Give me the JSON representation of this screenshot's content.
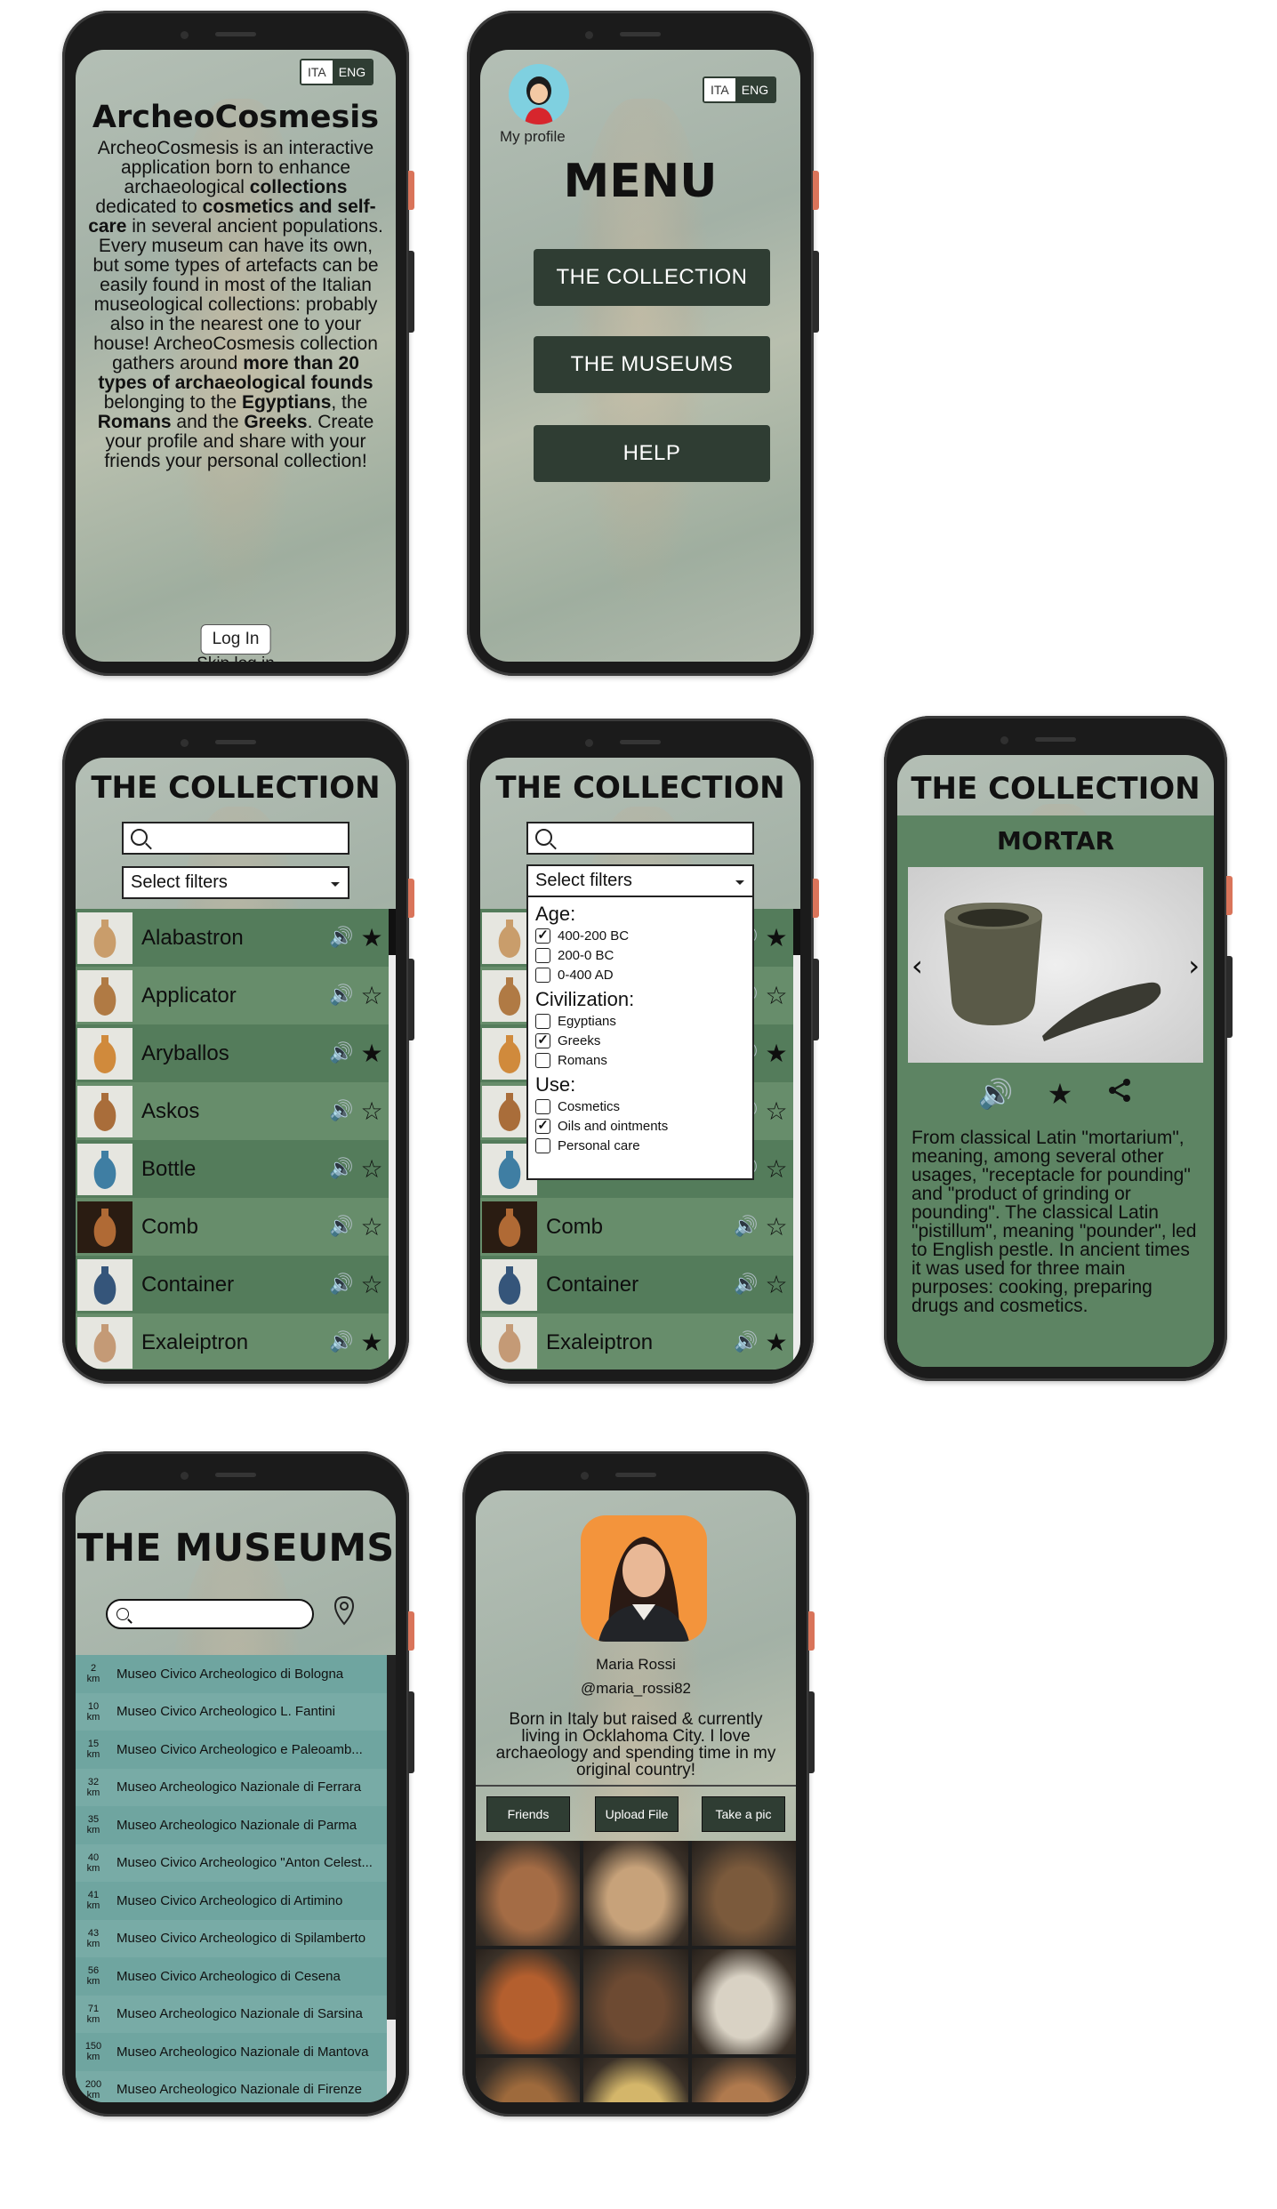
{
  "lang_toggle": {
    "ita": "ITA",
    "eng": "ENG"
  },
  "intro_screen": {
    "title": "ArcheoCosmesis",
    "description_parts": [
      {
        "t": "ArcheoCosmesis is an interactive application born to enhance archaeological ",
        "b": false
      },
      {
        "t": "collections",
        "b": true
      },
      {
        "t": " dedicated to ",
        "b": false
      },
      {
        "t": "cosmetics and self-care",
        "b": true
      },
      {
        "t": " in several ancient populations. Every museum can have its own, but some types of artefacts can be easily found in most of the Italian museological collections: probably also in the nearest one to your house! ArcheoCosmesis collection gathers around ",
        "b": false
      },
      {
        "t": "more than 20 types of archaeological founds",
        "b": true
      },
      {
        "t": " belonging to the ",
        "b": false
      },
      {
        "t": "Egyptians",
        "b": true
      },
      {
        "t": ", the ",
        "b": false
      },
      {
        "t": "Romans",
        "b": true
      },
      {
        "t": " and the ",
        "b": false
      },
      {
        "t": "Greeks",
        "b": true
      },
      {
        "t": ". Create your profile and share with your friends your personal collection!",
        "b": false
      }
    ],
    "login_label": "Log In",
    "skip_label": "Skip log in"
  },
  "menu_screen": {
    "profile_label": "My profile",
    "title": "MENU",
    "buttons": [
      "THE COLLECTION",
      "THE MUSEUMS",
      "HELP"
    ]
  },
  "collection_screen": {
    "title": "THE COLLECTION",
    "search_placeholder": "",
    "filter_label": "Select filters",
    "items": [
      {
        "name": "Alabastron",
        "favorite": true,
        "thumb_color": "#c99d6b"
      },
      {
        "name": "Applicator",
        "favorite": false,
        "thumb_color": "#b07a44"
      },
      {
        "name": "Aryballos",
        "favorite": true,
        "thumb_color": "#d08a3c"
      },
      {
        "name": "Askos",
        "favorite": false,
        "thumb_color": "#a96d3a"
      },
      {
        "name": "Bottle",
        "favorite": false,
        "thumb_color": "#3f7ea3"
      },
      {
        "name": "Comb",
        "favorite": false,
        "thumb_color": "#b06a35"
      },
      {
        "name": "Container",
        "favorite": false,
        "thumb_color": "#35557a"
      },
      {
        "name": "Exaleiptron",
        "favorite": true,
        "thumb_color": "#c49a76"
      }
    ]
  },
  "filters": {
    "age_title": "Age:",
    "age_options": [
      {
        "label": "400-200 BC",
        "checked": true
      },
      {
        "label": "200-0 BC",
        "checked": false
      },
      {
        "label": "0-400 AD",
        "checked": false
      }
    ],
    "civ_title": "Civilization:",
    "civ_options": [
      {
        "label": "Egyptians",
        "checked": false
      },
      {
        "label": "Greeks",
        "checked": true
      },
      {
        "label": "Romans",
        "checked": false
      }
    ],
    "use_title": "Use:",
    "use_options": [
      {
        "label": "Cosmetics",
        "checked": false
      },
      {
        "label": "Oils and ointments",
        "checked": true
      },
      {
        "label": "Personal care",
        "checked": false
      }
    ]
  },
  "detail_screen": {
    "title": "THE COLLECTION",
    "item_name": "MORTAR",
    "description": "From classical Latin \"mortarium\", meaning, among several other usages, \"receptacle for pounding\" and \"product of grinding or pounding\". The classical Latin \"pistillum\", meaning \"pounder\", led to English pestle. In ancient times it was used for three main purposes: cooking, preparing drugs and cosmetics."
  },
  "museums_screen": {
    "title": "THE MUSEUMS",
    "search_placeholder": "",
    "museums": [
      {
        "dist": "2",
        "unit": "km",
        "name": "Museo Civico Archeologico di Bologna"
      },
      {
        "dist": "10",
        "unit": "km",
        "name": "Museo Civico Archeologico L. Fantini"
      },
      {
        "dist": "15",
        "unit": "km",
        "name": "Museo Civico Archeologico e Paleoamb..."
      },
      {
        "dist": "32",
        "unit": "km",
        "name": "Museo Archeologico Nazionale di Ferrara"
      },
      {
        "dist": "35",
        "unit": "km",
        "name": "Museo Archeologico Nazionale di Parma"
      },
      {
        "dist": "40",
        "unit": "km",
        "name": "Museo Civico Archeologico \"Anton Celest..."
      },
      {
        "dist": "41",
        "unit": "km",
        "name": "Museo Civico Archeologico di Artimino"
      },
      {
        "dist": "43",
        "unit": "km",
        "name": "Museo Civico Archeologico di Spilamberto"
      },
      {
        "dist": "56",
        "unit": "km",
        "name": "Museo Civico Archeologico di Cesena"
      },
      {
        "dist": "71",
        "unit": "km",
        "name": "Museo Archeologico Nazionale di Sarsina"
      },
      {
        "dist": "150",
        "unit": "km",
        "name": "Museo Archeologico Nazionale di Mantova"
      },
      {
        "dist": "200",
        "unit": "km",
        "name": "Museo Archeologico Nazionale di Firenze"
      }
    ]
  },
  "profile_screen": {
    "name": "Maria Rossi",
    "handle": "@maria_rossi82",
    "bio": "Born in Italy but raised & currently living in Ocklahoma City. I love archaeology and spending time in my original country!",
    "buttons": [
      "Friends",
      "Upload File",
      "Take a pic"
    ],
    "gallery_colors": [
      "#a46c45",
      "#c7a27a",
      "#7b5a3c",
      "#b45f2e",
      "#6d4a32",
      "#d9d2c4",
      "#9e6a3c",
      "#d4b66a",
      "#b07a4e"
    ]
  },
  "colors": {
    "accent_dark": "#2f3d33",
    "list_green": "#547c5b",
    "museum_teal": "#6fa5a0",
    "profile_orange": "#f3943c"
  }
}
